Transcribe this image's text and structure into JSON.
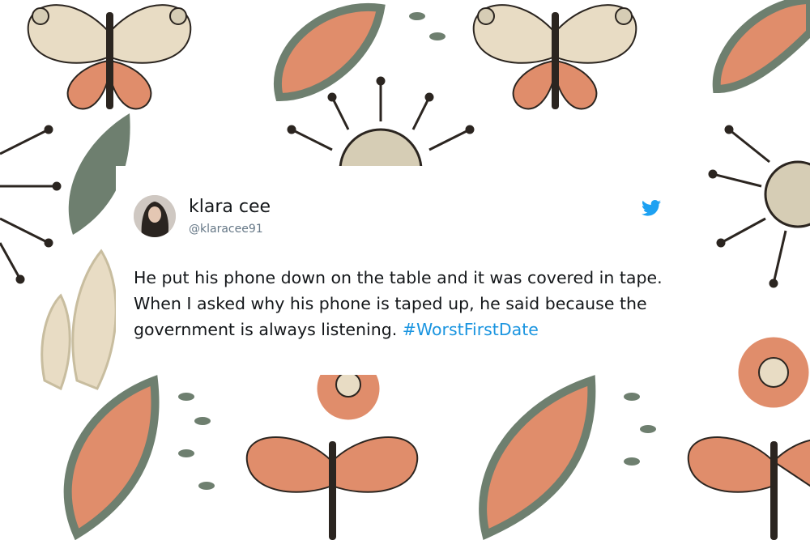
{
  "tweet": {
    "display_name": "klara cee",
    "handle": "@klaracee91",
    "text": "He put his phone down on the table and it was covered in tape. When I asked why his phone is taped up, he said because the government is always listening.",
    "hashtag": "#WorstFirstDate",
    "avatar_icon": "avatar-photo",
    "brand_icon": "twitter-bird-icon"
  },
  "colors": {
    "twitter_blue": "#1da1f2",
    "hashtag": "#1b95e0",
    "text": "#14171a",
    "handle": "#657786",
    "pattern_orange": "#e08d6b",
    "pattern_green": "#6e7f6f",
    "pattern_beige": "#d6cdb5",
    "pattern_dark": "#2b2520"
  }
}
